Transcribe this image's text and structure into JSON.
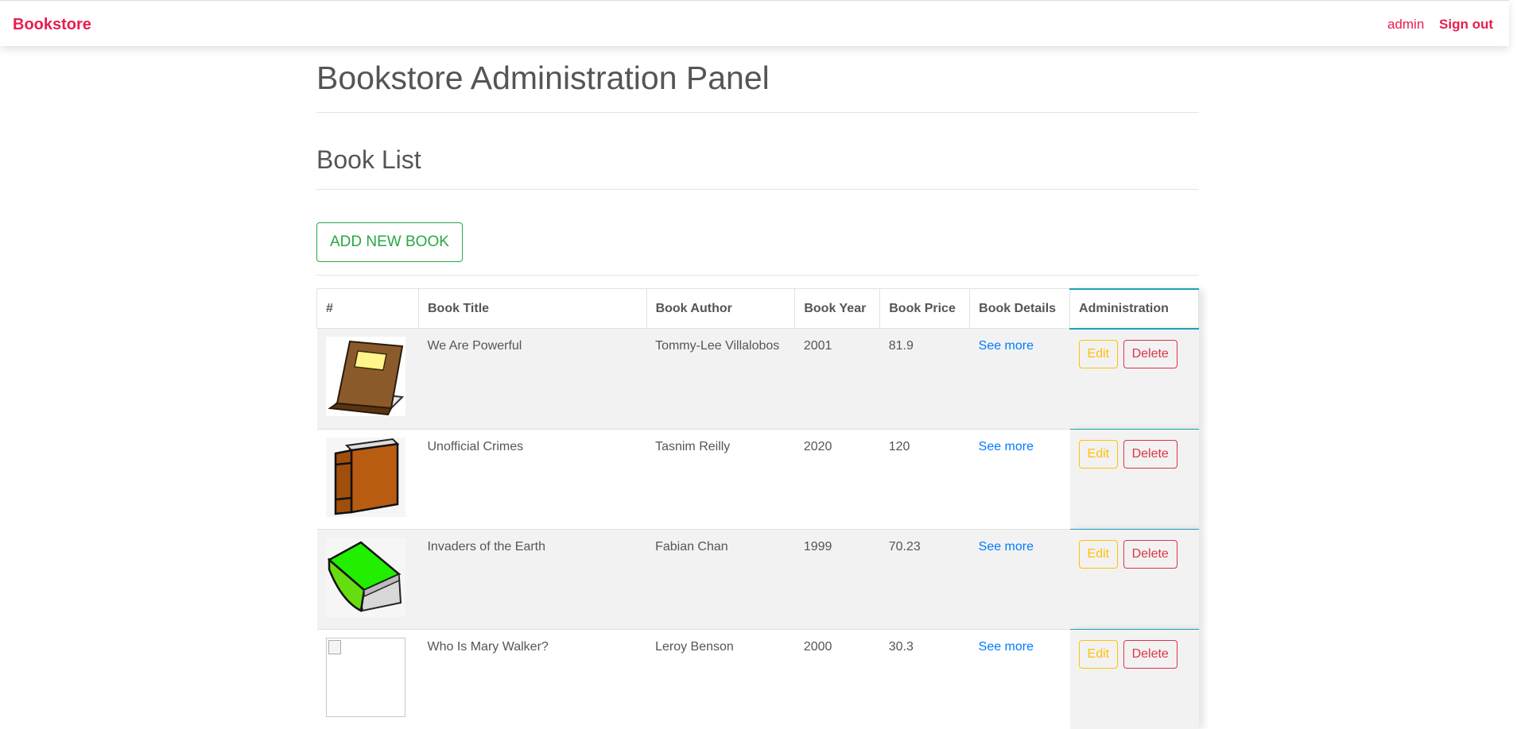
{
  "navbar": {
    "brand": "Bookstore",
    "user": "admin",
    "signout": "Sign out"
  },
  "page": {
    "title": "Bookstore Administration Panel",
    "section_title": "Book List",
    "add_button": "ADD NEW BOOK"
  },
  "table": {
    "headers": [
      "#",
      "Book Title",
      "Book Author",
      "Book Year",
      "Book Price",
      "Book Details",
      "Administration"
    ],
    "rows": [
      {
        "cover_icon": "brown-book-with-label-icon",
        "title": "We Are Powerful",
        "author": "Tommy-Lee Villalobos",
        "year": "2001",
        "price": "81.9",
        "details": "See more",
        "edit": "Edit",
        "delete": "Delete"
      },
      {
        "cover_icon": "orange-hardcover-book-icon",
        "title": "Unofficial Crimes",
        "author": "Tasnim Reilly",
        "year": "2020",
        "price": "120",
        "details": "See more",
        "edit": "Edit",
        "delete": "Delete"
      },
      {
        "cover_icon": "green-book-icon",
        "title": "Invaders of the Earth",
        "author": "Fabian Chan",
        "year": "1999",
        "price": "70.23",
        "details": "See more",
        "edit": "Edit",
        "delete": "Delete"
      },
      {
        "cover_icon": "broken-image-icon",
        "title": "Who Is Mary Walker?",
        "author": "Leroy Benson",
        "year": "2000",
        "price": "30.3",
        "details": "See more",
        "edit": "Edit",
        "delete": "Delete"
      }
    ]
  },
  "colors": {
    "brand": "#e91e4e",
    "success": "#28a745",
    "warning": "#ffc107",
    "danger": "#dc3545",
    "link": "#007bff",
    "info": "#17a2b8"
  }
}
